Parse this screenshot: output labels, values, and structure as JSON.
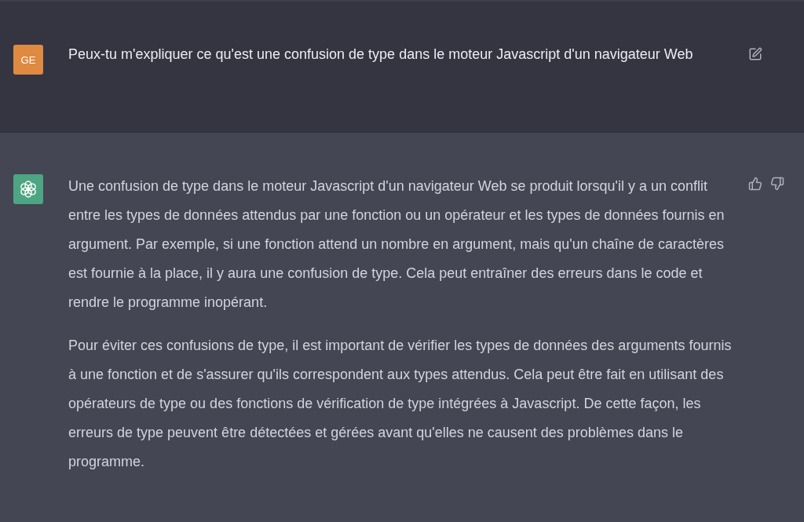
{
  "messages": [
    {
      "kind": "user",
      "avatar": "GE",
      "paragraphs": [
        "Peux-tu m'expliquer ce qu'est une confusion de type dans le moteur Javascript d'un navigateur Web"
      ]
    },
    {
      "kind": "assistant",
      "paragraphs": [
        "Une confusion de type dans le moteur Javascript d'un navigateur Web se produit lorsqu'il y a un conflit entre les types de données attendus par une fonction ou un opérateur et les types de données fournis en argument. Par exemple, si une fonction attend un nombre en argument, mais qu'un chaîne de caractères est fournie à la place, il y aura une confusion de type. Cela peut entraîner des erreurs dans le code et rendre le programme inopérant.",
        "Pour éviter ces confusions de type, il est important de vérifier les types de données des arguments fournis à une fonction et de s'assurer qu'ils correspondent aux types attendus. Cela peut être fait en utilisant des opérateurs de type ou des fonctions de vérification de type intégrées à Javascript. De cette façon, les erreurs de type peuvent être détectées et gérées avant qu'elles ne causent des problèmes dans le programme."
      ]
    }
  ]
}
